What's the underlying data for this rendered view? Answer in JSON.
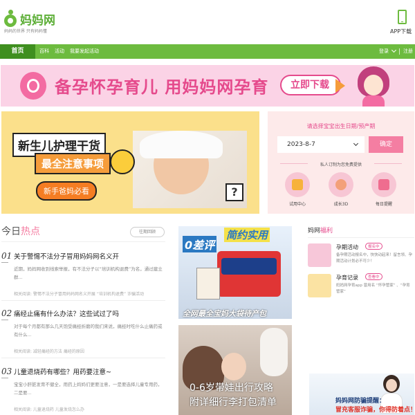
{
  "header": {
    "logo_name": "妈妈网",
    "logo_slogan": "妈妈的世界 只有妈妈懂",
    "app_download": "APP下载"
  },
  "nav": {
    "home": "首页",
    "links": [
      "百科",
      "活动",
      "我要发起活动"
    ],
    "login": "登录",
    "register": "注册"
  },
  "banner": {
    "text": "备孕怀孕育儿 用妈妈网孕育",
    "button": "立即下载"
  },
  "promo": {
    "title": "新生儿护理干货",
    "subtitle": "最全注意事项",
    "badge": "新手爸妈必看"
  },
  "date_panel": {
    "title": "请选择宝宝出生日期/预产期",
    "date_value": "2023-8-7",
    "confirm": "确定",
    "subtitle": "私人订制为您免费提供",
    "icons": [
      "试用中心",
      "成长3D",
      "每日提醒"
    ]
  },
  "hot": {
    "title_a": "今日",
    "title_b": "热点",
    "more": "往期回顾",
    "articles": [
      {
        "num": "01",
        "title": "关于警惕不法分子冒用妈妈网名义开",
        "desc": "近期，妈妈网收到线索举报，有不法分子以“培训机构退费”为名，通过建立群...",
        "related": "相关阅读: 警惕不法分子冒用妈妈网名义开展 “培训机构退费” 诈骗活动"
      },
      {
        "num": "02",
        "title": "痛经止痛有什么办法？这些试过了吗",
        "desc": "对于每个月都有那么几天饱受痛经折磨的我们来说，痛经时吃什么止痛药或有什么...",
        "related": "相关阅读: 减轻痛经的方法    痛经的原因"
      },
      {
        "num": "03",
        "title": "儿童退烧药有哪些？用药要注意~",
        "desc": "宝宝小肝脏发育不健全，用药上妈妈们更要注意，一是要选择儿童专用药，二是要...",
        "related": "相关阅读: 儿童退烧药    儿童发烧怎么办"
      }
    ]
  },
  "images": {
    "img1_tag1": "0差评",
    "img1_tag2": "简约实用",
    "img1_caption": "全网最全宝妈大袋待产包",
    "img2_line1": "0-6岁带娃出行攻略",
    "img2_line2": "附详细行李打包清单"
  },
  "welfare": {
    "title_a": "妈网",
    "title_b": "福利",
    "items": [
      {
        "title": "孕期活动",
        "badge": "报名中",
        "desc": "备孕期活动报名中，快快动起来！留言领、孕期活动计划必不可少！"
      },
      {
        "title": "孕育记录",
        "badge": "查看中",
        "desc": "妈妈网孕育app 曾用名 “怀孕管家” 、“孕育管家”"
      }
    ]
  },
  "ad": {
    "line1": "妈妈网防骗提醒：",
    "line2": "冒充客服诈骗，你得防着点！"
  },
  "colors": {
    "green": "#6dbb3f",
    "dark_green": "#3f8f1f",
    "pink": "#e54a8c"
  }
}
